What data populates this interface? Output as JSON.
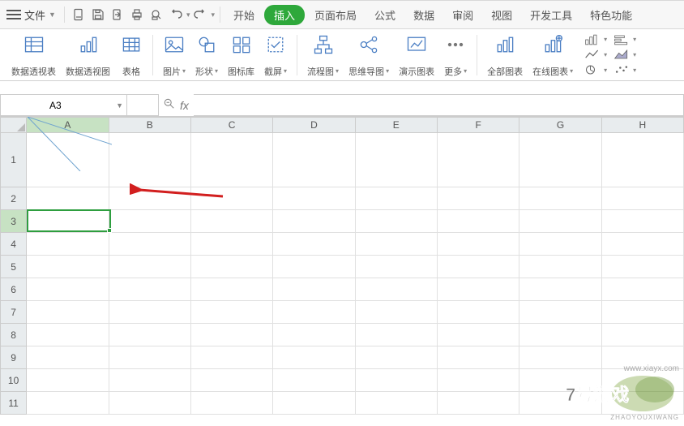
{
  "toolbar": {
    "file_label": "文件"
  },
  "tabs": {
    "home": "开始",
    "insert": "插入",
    "page_layout": "页面布局",
    "formulas": "公式",
    "data": "数据",
    "review": "审阅",
    "view": "视图",
    "developer": "开发工具",
    "special": "特色功能",
    "active": "insert"
  },
  "ribbon": {
    "pivot_table": "数据透视表",
    "pivot_chart": "数据透视图",
    "table": "表格",
    "picture": "图片",
    "shapes": "形状",
    "icon_lib": "图标库",
    "screenshot": "截屏",
    "flowchart": "流程图",
    "mindmap": "思维导图",
    "demo_chart": "演示图表",
    "more": "更多",
    "all_charts": "全部图表",
    "online_chart": "在线图表"
  },
  "namebox": {
    "value": "A3"
  },
  "formula": {
    "value": ""
  },
  "columns": [
    "A",
    "B",
    "C",
    "D",
    "E",
    "F",
    "G",
    "H"
  ],
  "col_widths": {
    "A": 104,
    "other": 104
  },
  "rows": [
    1,
    2,
    3,
    4,
    5,
    6,
    7,
    8,
    9,
    10,
    11
  ],
  "row_heights": {
    "1": 67,
    "default": 28
  },
  "selection": {
    "row": 3,
    "col": "A"
  },
  "colors": {
    "accent": "#2ea83b",
    "selection": "#2e9e3f",
    "header_hl": "#c7e2c3",
    "icon_blue": "#4a7ec3",
    "arrow": "#d21f1f"
  },
  "watermark": {
    "logo_text": "7号游戏",
    "url": "www.xiayx.com",
    "sub": "ZHAOYOUXIWANG"
  }
}
